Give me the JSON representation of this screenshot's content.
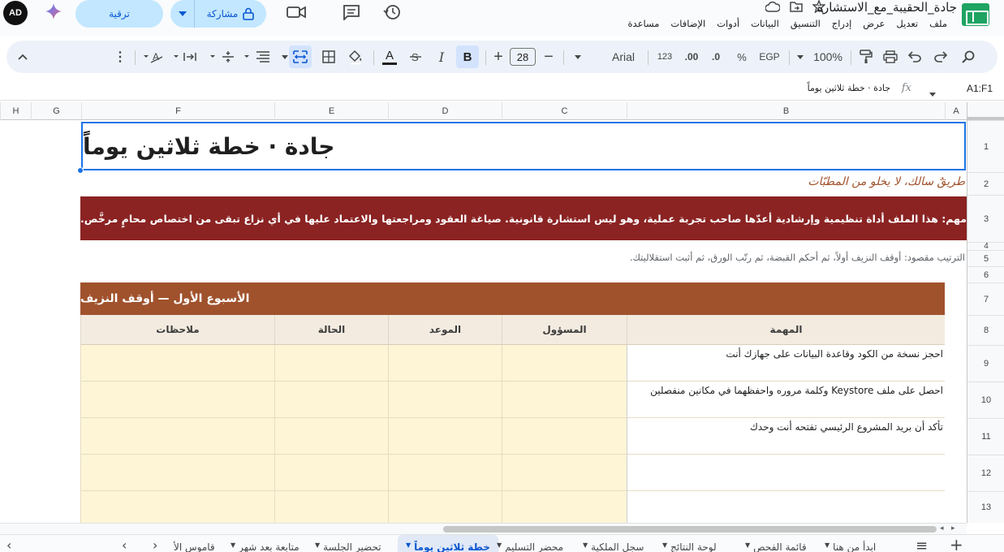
{
  "titlebar": {
    "avatar_initials": "AD",
    "upgrade_label": "ترقية",
    "share_label": "مشاركة",
    "doc_title": "جادة_الحقيبة_مع_الاستشارة"
  },
  "menu": [
    "ملف",
    "تعديل",
    "عرض",
    "إدراج",
    "التنسيق",
    "البيانات",
    "أدوات",
    "الإضافات",
    "مساعدة"
  ],
  "toolbar": {
    "zoom": "100%",
    "currency": "EGP",
    "percent": "%",
    "decimal_dec": ".0",
    "decimal_inc": ".00",
    "number_format": "123",
    "font_name": "Arial",
    "font_size": "28",
    "bold": "B",
    "italic": "I",
    "text_color": "A"
  },
  "formula": {
    "name_box": "A1:F1",
    "content": "جادة · خطة ثلاثين يوماً"
  },
  "columns": [
    "A",
    "B",
    "C",
    "D",
    "E",
    "F",
    "G",
    "H"
  ],
  "rows": [
    "1",
    "2",
    "3",
    "4",
    "5",
    "6",
    "7",
    "8",
    "9",
    "10",
    "11",
    "12",
    "13"
  ],
  "sheet": {
    "title": "جادة · خطة ثلاثين يوماً",
    "subtitle": "طريقٌ سالك، لا يخلو من المطبّات",
    "warning": "تنبيه مهم: هذا الملف أداة تنظيمية وإرشادية أعدّها صاحب تجربة عملية، وهو ليس استشارة قانونية. صياغة العقود ومراجعتها والاعتماد عليها في أي نزاع تبقى من اختصاص محامٍ مرخَّص.",
    "order_note": "الترتيب مقصود: أوقف النزيف أولاً، ثم أحكم القبضة، ثم رتّب الورق، ثم أثبت استقلاليتك.",
    "week1_header": "الأسبوع الأول — أوقف النزيف",
    "table_headers": {
      "task": "المهمة",
      "owner": "المسؤول",
      "due": "الموعد",
      "status": "الحالة",
      "notes": "ملاحظات"
    },
    "tasks": [
      "احجز نسخة من الكود وقاعدة البيانات على جهازك أنت",
      "احصل على ملف Keystore وكلمة مروره واحفظهما في مكانين منفصلين",
      "تأكد أن بريد المشروع الرئيسي تفتحه أنت وحدك",
      "",
      ""
    ]
  },
  "tabs": [
    {
      "label": "ابدأ من هنا"
    },
    {
      "label": "قائمة الفحص"
    },
    {
      "label": "لوحة النتائج"
    },
    {
      "label": "سجل الملكية"
    },
    {
      "label": "محضر التسليم"
    },
    {
      "label": "خطة ثلاثين يوماً",
      "active": true
    },
    {
      "label": "تحضير الجلسة"
    },
    {
      "label": "متابعة بعد شهر"
    },
    {
      "label": "قاموس الأ"
    }
  ],
  "colors": {
    "warning_bg": "#8b2323",
    "week_header_bg": "#a0522d",
    "subtitle": "#a0522d",
    "selection": "#1a73e8",
    "cell_yellow": "#fdf5d6"
  }
}
